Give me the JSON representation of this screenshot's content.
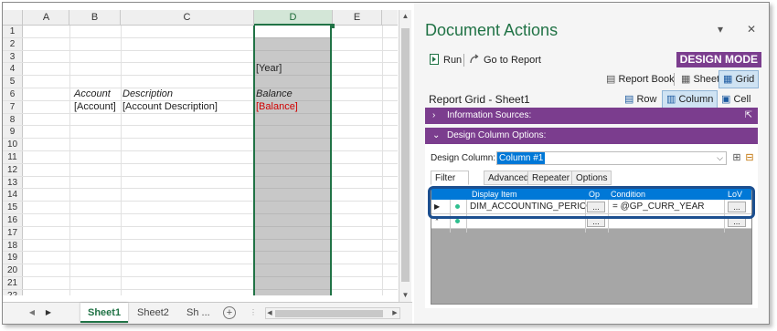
{
  "sheet": {
    "columns": [
      "A",
      "B",
      "C",
      "D",
      "E"
    ],
    "selected_column": "D",
    "row_numbers": [
      "1",
      "2",
      "3",
      "4",
      "5",
      "6",
      "7",
      "8",
      "9",
      "10",
      "11",
      "12",
      "13",
      "14",
      "15",
      "16",
      "17",
      "18",
      "19",
      "20",
      "21",
      "22"
    ],
    "cells": {
      "d4": "[Year]",
      "b6": "Account",
      "c6": "Description",
      "d6": "Balance",
      "b7": "[Account]",
      "c7": "[Account Description]",
      "d7": "[Balance]"
    },
    "tabs": [
      "Sheet1",
      "Sheet2",
      "Sh ..."
    ],
    "active_tab": "Sheet1"
  },
  "panel": {
    "title": "Document Actions",
    "minimize_glyph": "▾",
    "close_glyph": "✕",
    "toolbar": {
      "run": "Run",
      "go_to_report": "Go to Report",
      "design_mode": "DESIGN MODE",
      "report_book": "Report Book",
      "sheet": "Sheet",
      "grid": "Grid"
    },
    "grid_title": "Report Grid - Sheet1",
    "row_label": "Row",
    "column_label": "Column",
    "cell_label": "Cell",
    "information_sources": "Information Sources:",
    "design_column_options": "Design Column Options:",
    "design_column_label": "Design Column:",
    "design_column_value": "Column #1",
    "subtabs": [
      "Filter Criteria",
      "Advanced",
      "Repeater",
      "Options"
    ],
    "filter_grid": {
      "headers": [
        "Display Item",
        "Op",
        "Condition",
        "LoV"
      ],
      "rows": [
        {
          "display_item": "DIM_ACCOUNTING_PERIOD.A(",
          "op": "...",
          "condition": "= @GP_CURR_YEAR",
          "lov": "..."
        },
        {
          "display_item": "",
          "op": "...",
          "condition": "",
          "lov": "..."
        }
      ],
      "row_marker": "▶",
      "new_row_marker": "*"
    }
  },
  "colors": {
    "excel_green": "#217346",
    "design_purple": "#7b3d8e",
    "highlight_blue": "#0078d7",
    "balance_red": "#d00000"
  }
}
